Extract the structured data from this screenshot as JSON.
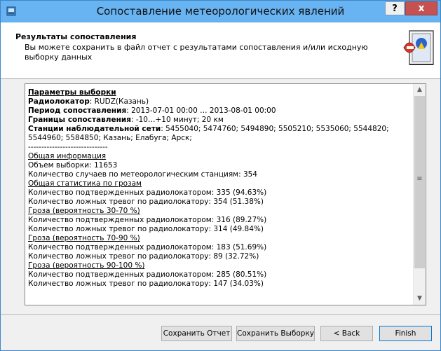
{
  "window": {
    "title": "Сопоставление метеорологических явлений",
    "help_label": "?",
    "close_label": "x"
  },
  "header": {
    "title": "Результаты сопоставления",
    "description": "Вы можете сохранить в файл отчет с результатами сопоставления и/или исходную выборку данных"
  },
  "report": {
    "params_heading": "Параметры выборки",
    "radar_label": "Радиолокатор",
    "radar_value": ": RUDZ(Казань)",
    "period_label": "Период сопоставления",
    "period_value": ": 2013-07-01 00:00 … 2013-08-01 00:00",
    "bounds_label": "Границы сопоставления",
    "bounds_value": ": -10…+10 минут; 20 км",
    "stations_label": "Станции наблюдательной сети",
    "stations_value": ": 5455040; 5474760; 5494890; 5505210; 5535060; 5544820; 5544960; 5584850; Казань; Елабуга; Арск;",
    "divider": "------------------------------",
    "general_heading": "Общая информация",
    "sample_size": "Объем выборки: 11653",
    "station_cases": "Количество случаев по метеорологическим станциям: 354",
    "storm_stats_heading": "Общая статистика по грозам",
    "all_confirmed": "Количество подтвержденных радиолокатором: 335 (94.63%)",
    "all_false": "Количество ложных тревог по радиолокатору: 354 (51.38%)",
    "p30_heading": "Гроза (вероятность 30-70 %)",
    "p30_confirmed": "Количество подтвержденных радиолокатором: 316 (89.27%)",
    "p30_false": "Количество ложных тревог по радиолокатору: 314 (49.84%)",
    "p70_heading": "Гроза (вероятность 70-90 %)",
    "p70_confirmed": "Количество подтвержденных радиолокатором: 183 (51.69%)",
    "p70_false": "Количество ложных тревог по радиолокатору: 89 (32.72%)",
    "p90_heading": "Гроза (вероятность 90-100 %)",
    "p90_confirmed": "Количество подтвержденных радиолокатором: 285 (80.51%)",
    "p90_false": "Количество ложных тревог по радиолокатору: 147 (34.03%)"
  },
  "scrollbar": {
    "up_glyph": "▲",
    "down_glyph": "▼",
    "grip_glyph": "≡"
  },
  "buttons": {
    "save_report": "Сохранить Отчет",
    "save_sample": "Сохранить Выборку",
    "back": "< Back",
    "finish": "Finish"
  },
  "colors": {
    "titlebar": "#68b3f2",
    "close": "#c75050",
    "accent_border": "#0078d7"
  }
}
